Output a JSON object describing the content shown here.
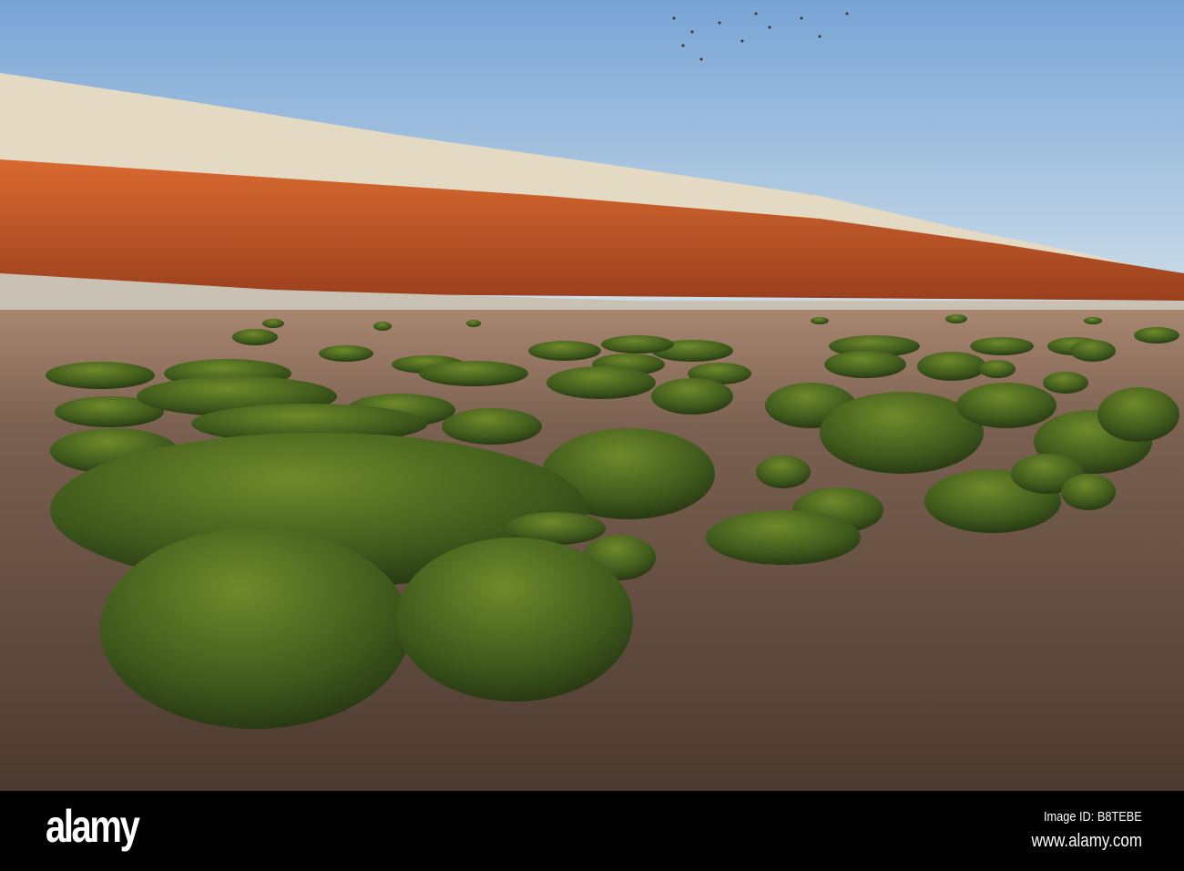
{
  "photo": {
    "subject": "Striped red and white chalk cliffs with seaweed-covered boulders on a sandy beach at low tide",
    "colors": {
      "sky_top": "#7aa6d6",
      "sky_bottom": "#cbdde9",
      "chalk": "#e6dcc6",
      "red_band": "#c8582a",
      "sand": "#6e5648",
      "moss": "#3f5a1c"
    }
  },
  "watermark": {
    "brand": "alamy",
    "image_id": "Image ID: B8TEBE",
    "website": "www.alamy.com"
  }
}
